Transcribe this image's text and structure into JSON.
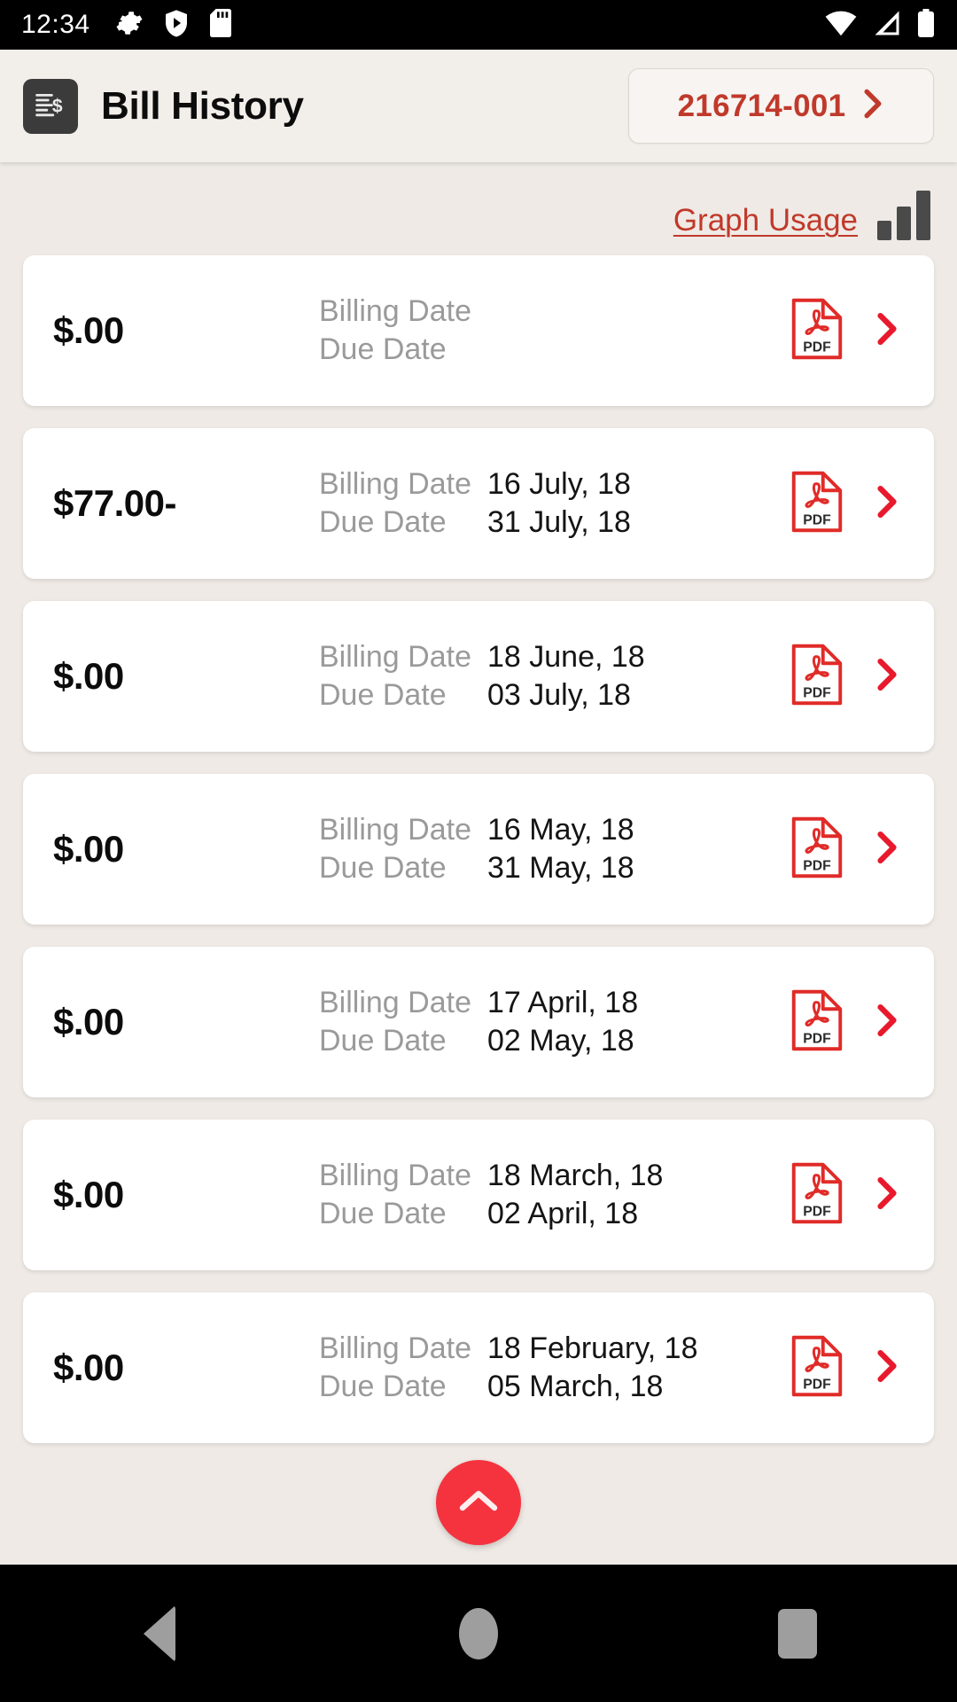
{
  "status_bar": {
    "time": "12:34",
    "left_icons": [
      "gear-icon",
      "play-protect-shield-icon",
      "sd-card-icon"
    ],
    "right_icons": [
      "wifi-icon",
      "cellular-signal-icon",
      "battery-icon"
    ]
  },
  "header": {
    "app_icon": "bill-document-dollar-icon",
    "title": "Bill History",
    "account": {
      "number": "216714-001",
      "chevron": "chevron-right-icon"
    }
  },
  "toolbar": {
    "graph_usage_label": "Graph Usage",
    "graph_icon": "bar-chart-icon"
  },
  "labels": {
    "billing_date": "Billing Date",
    "due_date": "Due Date",
    "pdf": "PDF"
  },
  "colors": {
    "accent_red": "#c0392b",
    "fab_red": "#f5333f",
    "chevron_red": "#e8192c",
    "background": "#efeae5",
    "card": "#ffffff",
    "label_gray": "#9a9a9a"
  },
  "bills": [
    {
      "amount": "$.00",
      "billing_date": "",
      "due_date": ""
    },
    {
      "amount": "$77.00-",
      "billing_date": "16 July, 18",
      "due_date": "31 July, 18"
    },
    {
      "amount": "$.00",
      "billing_date": "18 June, 18",
      "due_date": "03 July, 18"
    },
    {
      "amount": "$.00",
      "billing_date": "16 May, 18",
      "due_date": "31 May, 18"
    },
    {
      "amount": "$.00",
      "billing_date": "17 April, 18",
      "due_date": "02 May, 18"
    },
    {
      "amount": "$.00",
      "billing_date": "18 March, 18",
      "due_date": "02 April, 18"
    },
    {
      "amount": "$.00",
      "billing_date": "18 February, 18",
      "due_date": "05 March, 18"
    }
  ],
  "fab": {
    "icon": "chevron-up-icon"
  },
  "nav_bar": {
    "back": "back-triangle-icon",
    "home": "home-circle-icon",
    "recents": "recents-square-icon"
  }
}
